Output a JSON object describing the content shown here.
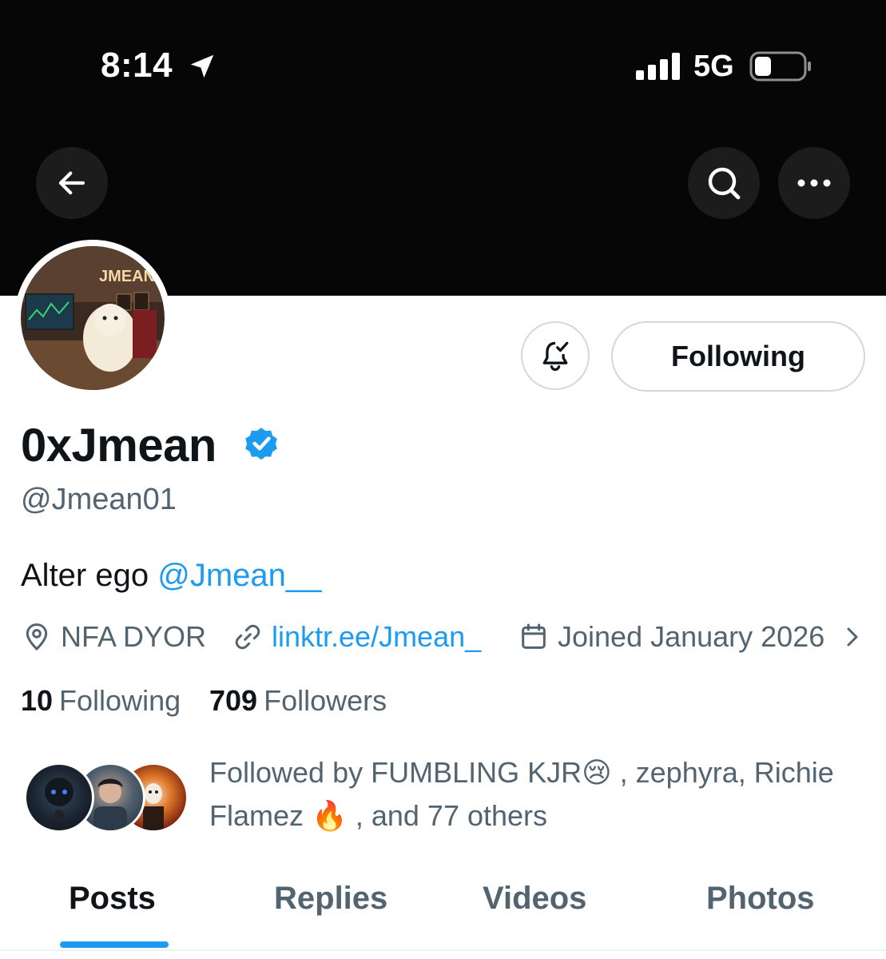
{
  "status_bar": {
    "time": "8:14",
    "network": "5G"
  },
  "profile": {
    "avatar_sign_text": "JMEAN",
    "display_name": "0xJmean",
    "handle": "@Jmean01",
    "bio_text": "Alter ego ",
    "bio_mention": "@Jmean__",
    "location": "NFA DYOR",
    "link": "linktr.ee/Jmean_",
    "joined": "Joined January 2026",
    "following_count": "10",
    "following_label": "Following",
    "followers_count": "709",
    "followers_label": "Followers",
    "followed_by": "Followed by FUMBLING KJR😢 , zephyra, Richie Flamez 🔥 , and 77 others"
  },
  "actions": {
    "follow_state": "Following"
  },
  "tabs": [
    {
      "label": "Posts",
      "active": true
    },
    {
      "label": "Replies",
      "active": false
    },
    {
      "label": "Videos",
      "active": false
    },
    {
      "label": "Photos",
      "active": false
    }
  ],
  "colors": {
    "accent": "#1d9bf0",
    "secondary_text": "#536471",
    "banner": "#060606"
  },
  "icons": [
    "location-arrow-icon",
    "signal-icon",
    "battery-icon",
    "back-arrow-icon",
    "search-icon",
    "more-icon",
    "bell-check-icon",
    "verified-badge-icon",
    "location-pin-icon",
    "link-icon",
    "calendar-icon",
    "chevron-right-icon"
  ]
}
